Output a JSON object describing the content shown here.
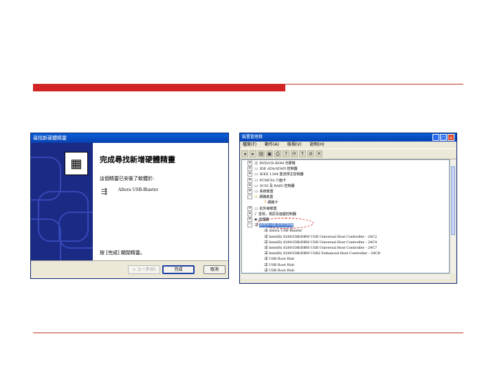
{
  "wizard": {
    "title": "尋找新硬體精靈",
    "heading": "完成尋找新增硬體精靈",
    "line1": "這個精靈已安裝了軟體於:",
    "device": "Altera USB-Blaster",
    "line2": "按 [完成] 關閉精靈。",
    "buttons": {
      "back": "< 上一步(B)",
      "finish": "完成",
      "cancel": "取消"
    }
  },
  "devmgr": {
    "title": "裝置管理員",
    "menu": [
      "檔案(F)",
      "動作(A)",
      "檢視(V)",
      "說明(H)"
    ],
    "tree": [
      {
        "text": "DVD/CD-ROM 光碟機",
        "expander": "+",
        "icon": "cdrom-icon",
        "indent": 0
      },
      {
        "text": "IDE ATA/ATAPI 控制器",
        "expander": "+",
        "icon": "ide-icon",
        "indent": 0
      },
      {
        "text": "IEEE 1394 匯流排主控制器",
        "expander": "+",
        "icon": "ieee1394-icon",
        "indent": 0
      },
      {
        "text": "PCMCIA 介面卡",
        "expander": "+",
        "icon": "pcmcia-icon",
        "indent": 0
      },
      {
        "text": "SCSI 及 RAID 控制器",
        "expander": "+",
        "icon": "scsi-icon",
        "indent": 0
      },
      {
        "text": "系統裝置",
        "expander": "+",
        "icon": "system-icon",
        "indent": 0
      },
      {
        "text": "網路裝置",
        "expander": "-",
        "icon": "network-warning-icon",
        "indent": 0,
        "warn": true
      },
      {
        "text": "網路卡",
        "expander": "",
        "icon": "unknown-device-icon",
        "indent": 1,
        "warn": true
      },
      {
        "text": "紅外線裝置",
        "expander": "+",
        "icon": "infrared-icon",
        "indent": 0
      },
      {
        "text": "音效，視訊及遊戲控制器",
        "expander": "+",
        "icon": "sound-icon",
        "indent": 0
      },
      {
        "text": "處理器",
        "expander": "+",
        "icon": "processor-icon",
        "indent": 0
      },
      {
        "text": "通用序列匯流排控制器",
        "expander": "-",
        "icon": "usb-icon",
        "indent": 0,
        "selected": true
      },
      {
        "text": "Altera USB-Blaster",
        "expander": "",
        "icon": "usb-icon",
        "indent": 1
      },
      {
        "text": "Intel(R) 82801DB/DBM USB Universal Host Controller - 24C2",
        "expander": "",
        "icon": "usb-icon",
        "indent": 1
      },
      {
        "text": "Intel(R) 82801DB/DBM USB Universal Host Controller - 24C4",
        "expander": "",
        "icon": "usb-icon",
        "indent": 1
      },
      {
        "text": "Intel(R) 82801DB/DBM USB Universal Host Controller - 24C7",
        "expander": "",
        "icon": "usb-icon",
        "indent": 1
      },
      {
        "text": "Intel(R) 82801DB/DBM USB2 Enhanced Host Controller - 24CD",
        "expander": "",
        "icon": "usb-icon",
        "indent": 1
      },
      {
        "text": "USB Root Hub",
        "expander": "",
        "icon": "usb-icon",
        "indent": 1
      },
      {
        "text": "USB Root Hub",
        "expander": "",
        "icon": "usb-icon",
        "indent": 1
      },
      {
        "text": "USB Root Hub",
        "expander": "",
        "icon": "usb-icon",
        "indent": 1
      }
    ]
  }
}
